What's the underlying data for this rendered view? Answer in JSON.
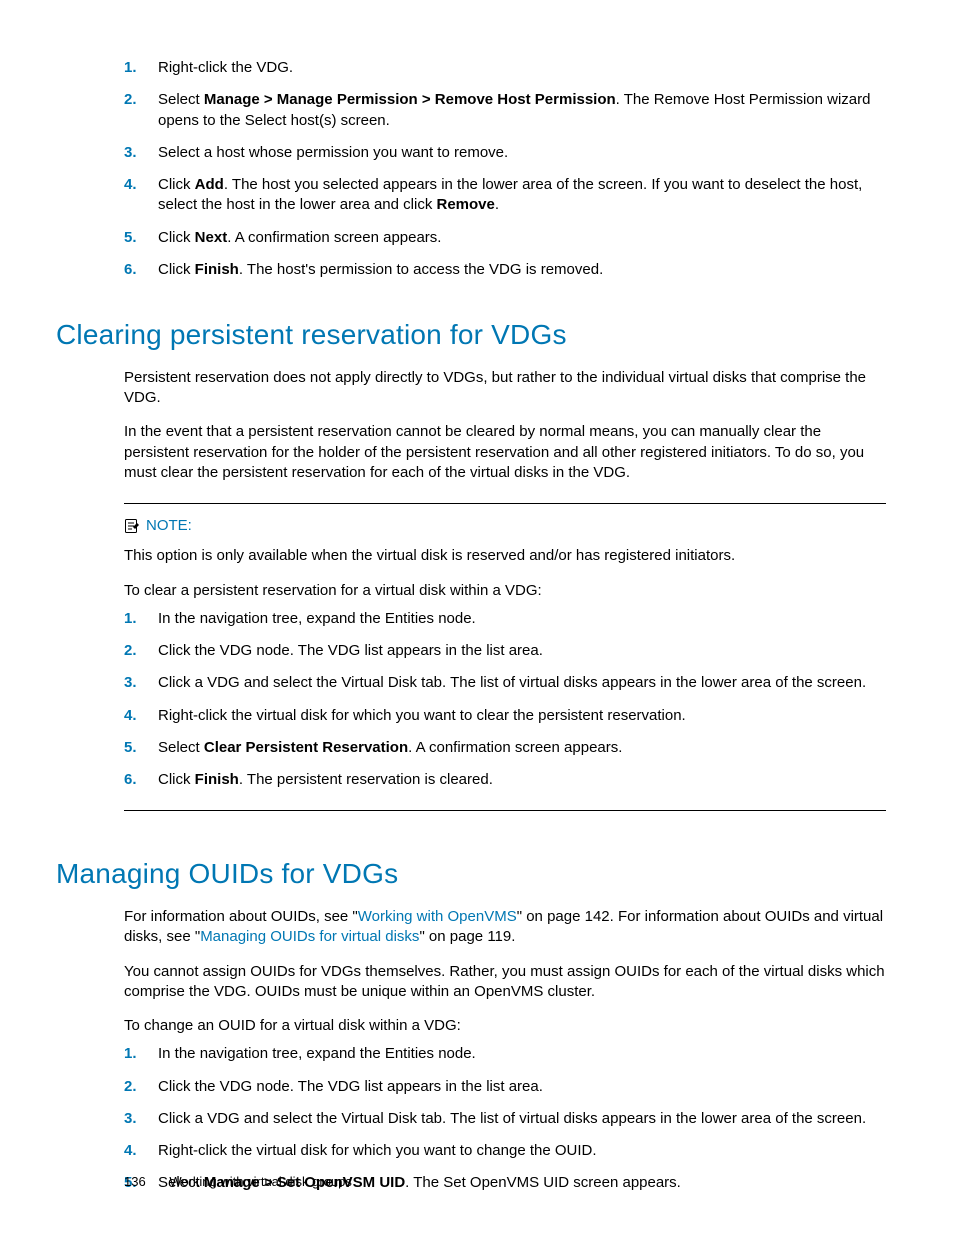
{
  "topList": {
    "items": [
      {
        "num": "1.",
        "html": "Right-click the VDG."
      },
      {
        "num": "2.",
        "html": "Select <b>Manage > Manage Permission > Remove Host Permission</b>. The Remove Host Permission wizard opens to the Select host(s) screen."
      },
      {
        "num": "3.",
        "html": "Select a host whose permission you want to remove."
      },
      {
        "num": "4.",
        "html": "Click <b>Add</b>. The host you selected appears in the lower area of the screen. If you want to deselect the host, select the host in the lower area and click <b>Remove</b>."
      },
      {
        "num": "5.",
        "html": "Click <b>Next</b>. A confirmation screen appears."
      },
      {
        "num": "6.",
        "html": "Click <b>Finish</b>. The host's permission to access the VDG is removed."
      }
    ]
  },
  "sectionA": {
    "title": "Clearing persistent reservation for VDGs",
    "p1": "Persistent reservation does not apply directly to VDGs, but rather to the individual virtual disks that comprise the VDG.",
    "p2": "In the event that a persistent reservation cannot be cleared by normal means, you can manually clear the persistent reservation for the holder of the persistent reservation and all other registered initiators. To do so, you must clear the persistent reservation for each of the virtual disks in the VDG.",
    "noteLabel": "NOTE:",
    "noteText": "This option is only available when the virtual disk is reserved and/or has registered initiators.",
    "lead": "To clear a persistent reservation for a virtual disk within a VDG:",
    "items": [
      {
        "num": "1.",
        "html": "In the navigation tree, expand the Entities node."
      },
      {
        "num": "2.",
        "html": "Click the VDG node. The VDG list appears in the list area."
      },
      {
        "num": "3.",
        "html": "Click a VDG and select the Virtual Disk tab. The list of virtual disks appears in the lower area of the screen."
      },
      {
        "num": "4.",
        "html": "Right-click the virtual disk for which you want to clear the persistent reservation."
      },
      {
        "num": "5.",
        "html": "Select <b>Clear Persistent Reservation</b>. A confirmation screen appears."
      },
      {
        "num": "6.",
        "html": "Click <b>Finish</b>. The persistent reservation is cleared."
      }
    ]
  },
  "sectionB": {
    "title": "Managing OUIDs for VDGs",
    "p1": "For information about OUIDs, see \"<span class='link'>Working with OpenVMS</span>\" on page 142. For information about OUIDs and virtual disks, see \"<span class='link'>Managing OUIDs for virtual disks</span>\" on page 119.",
    "p2": "You cannot assign OUIDs for VDGs themselves. Rather, you must assign OUIDs for each of the virtual disks which comprise the VDG. OUIDs must be unique within an OpenVMS cluster.",
    "lead": "To change an OUID for a virtual disk within a VDG:",
    "items": [
      {
        "num": "1.",
        "html": "In the navigation tree, expand the Entities node."
      },
      {
        "num": "2.",
        "html": "Click the VDG node. The VDG list appears in the list area."
      },
      {
        "num": "3.",
        "html": "Click a VDG and select the Virtual Disk tab. The list of virtual disks appears in the lower area of the screen."
      },
      {
        "num": "4.",
        "html": "Right-click the virtual disk for which you want to change the OUID."
      },
      {
        "num": "5.",
        "html": "Select <b>Manage > Set OpenVSM UID</b>. The Set OpenVMS UID screen appears."
      }
    ]
  },
  "footer": {
    "pageNumber": "136",
    "chapter": "Working with virtual disk groups"
  },
  "links": {
    "openvms": "Working with OpenVMS",
    "ouids": "Managing OUIDs for virtual disks"
  }
}
